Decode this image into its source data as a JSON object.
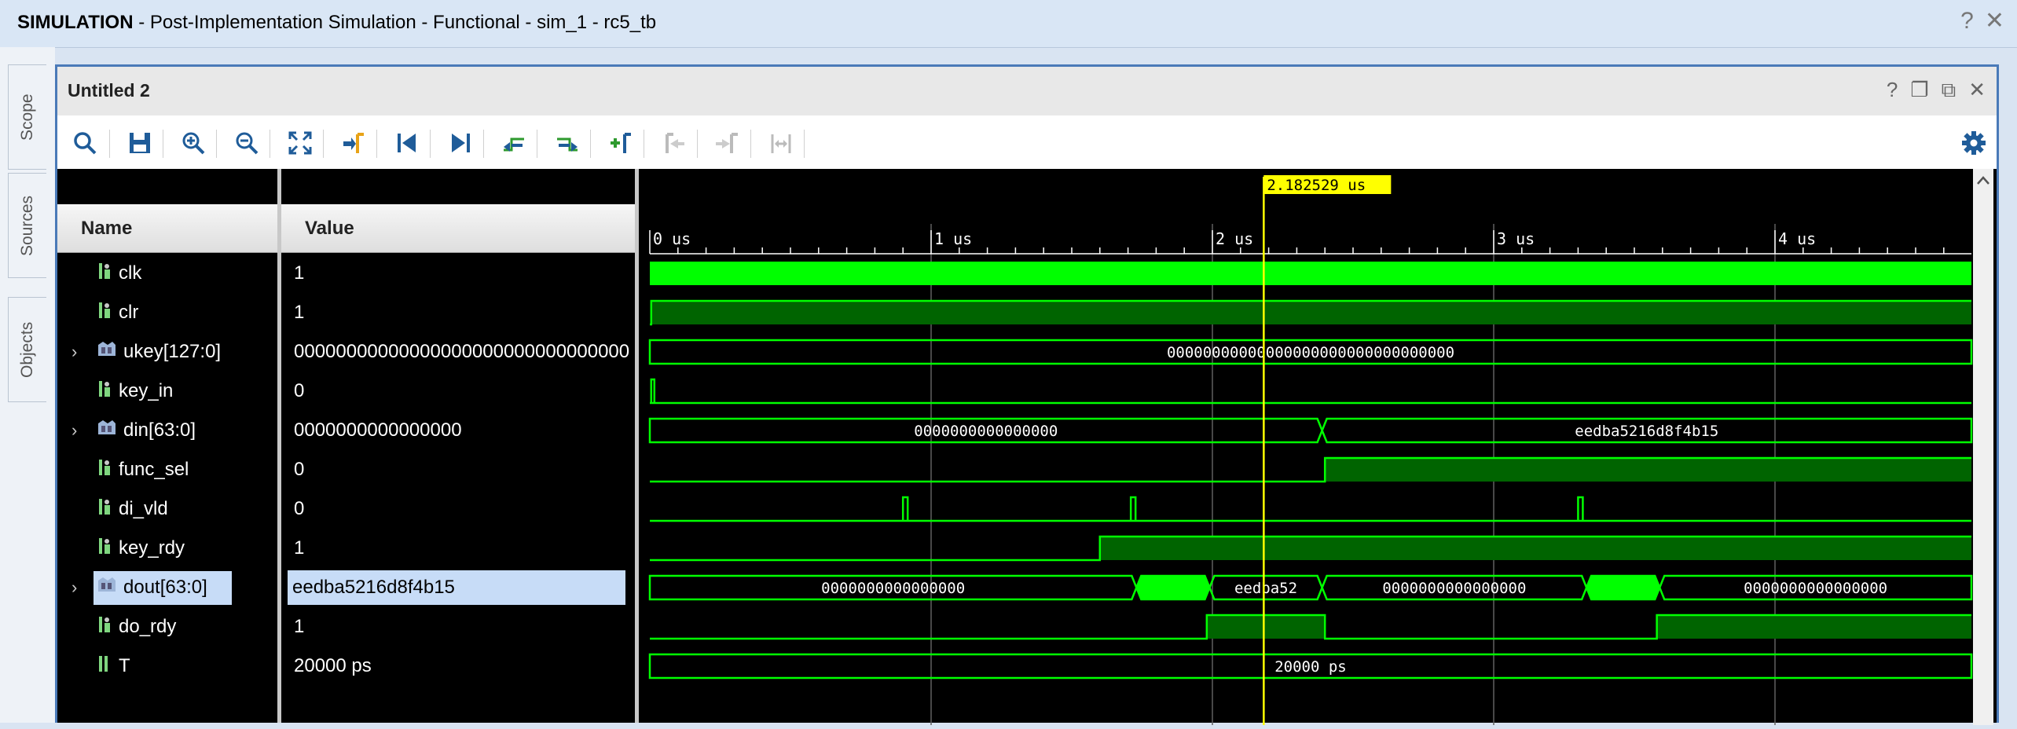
{
  "titlebar": {
    "mode": "SIMULATION",
    "subtitle": " - Post-Implementation Simulation - Functional - sim_1 - rc5_tb",
    "help_icon": "?",
    "close_icon": "✕"
  },
  "sidebar": {
    "tabs": [
      {
        "label": "Scope"
      },
      {
        "label": "Sources"
      },
      {
        "label": "Objects"
      }
    ]
  },
  "window": {
    "title": "Untitled 2",
    "icons": {
      "help": "?",
      "restore": "❐",
      "float": "⧉",
      "close": "✕"
    }
  },
  "toolbar": {
    "icons": [
      "search-icon",
      "save-icon",
      "zoom-in-icon",
      "zoom-out-icon",
      "zoom-fit-icon",
      "go-to-cursor-icon",
      "go-to-time-zero-icon",
      "go-to-last-time-icon",
      "previous-transition-icon",
      "next-transition-icon",
      "add-marker-icon",
      "previous-marker-icon",
      "next-marker-icon",
      "swap-cursors-icon",
      "settings-icon"
    ]
  },
  "columns": {
    "name": "Name",
    "value": "Value"
  },
  "cursor": {
    "time_label": "2.182529 us"
  },
  "ruler": {
    "labels": [
      "0 us",
      "1 us",
      "2 us",
      "3 us",
      "4 us"
    ]
  },
  "signals": [
    {
      "name": "clk",
      "value": "1",
      "expandable": false,
      "type": "bit"
    },
    {
      "name": "clr",
      "value": "1",
      "expandable": false,
      "type": "bit"
    },
    {
      "name": "ukey[127:0]",
      "value": "00000000000000000000000000000000",
      "expandable": true,
      "type": "bus"
    },
    {
      "name": "key_in",
      "value": "0",
      "expandable": false,
      "type": "bit"
    },
    {
      "name": "din[63:0]",
      "value": "0000000000000000",
      "expandable": true,
      "type": "bus"
    },
    {
      "name": "func_sel",
      "value": "0",
      "expandable": false,
      "type": "bit"
    },
    {
      "name": "di_vld",
      "value": "0",
      "expandable": false,
      "type": "bit"
    },
    {
      "name": "key_rdy",
      "value": "1",
      "expandable": false,
      "type": "bit"
    },
    {
      "name": "dout[63:0]",
      "value": "eedba5216d8f4b15",
      "expandable": true,
      "type": "bus",
      "selected": true
    },
    {
      "name": "do_rdy",
      "value": "1",
      "expandable": false,
      "type": "bit"
    },
    {
      "name": "T",
      "value": "20000 ps",
      "expandable": false,
      "type": "param"
    }
  ],
  "wave_labels": {
    "ukey": "00000000000000000000000000000000",
    "din_a": "0000000000000000",
    "din_b": "eedba5216d8f4b15",
    "dout_a": "0000000000000000",
    "dout_b": "eedba52",
    "dout_c": "0000000000000000",
    "dout_d": "0000000000000000",
    "t": "20000 ps"
  },
  "colors": {
    "wave": "#00ff00",
    "wave_fill": "#006400",
    "cursor": "#ffff00",
    "grid": "#606060",
    "selection": "#c7dcf7",
    "window_border": "#4a7ab8"
  }
}
